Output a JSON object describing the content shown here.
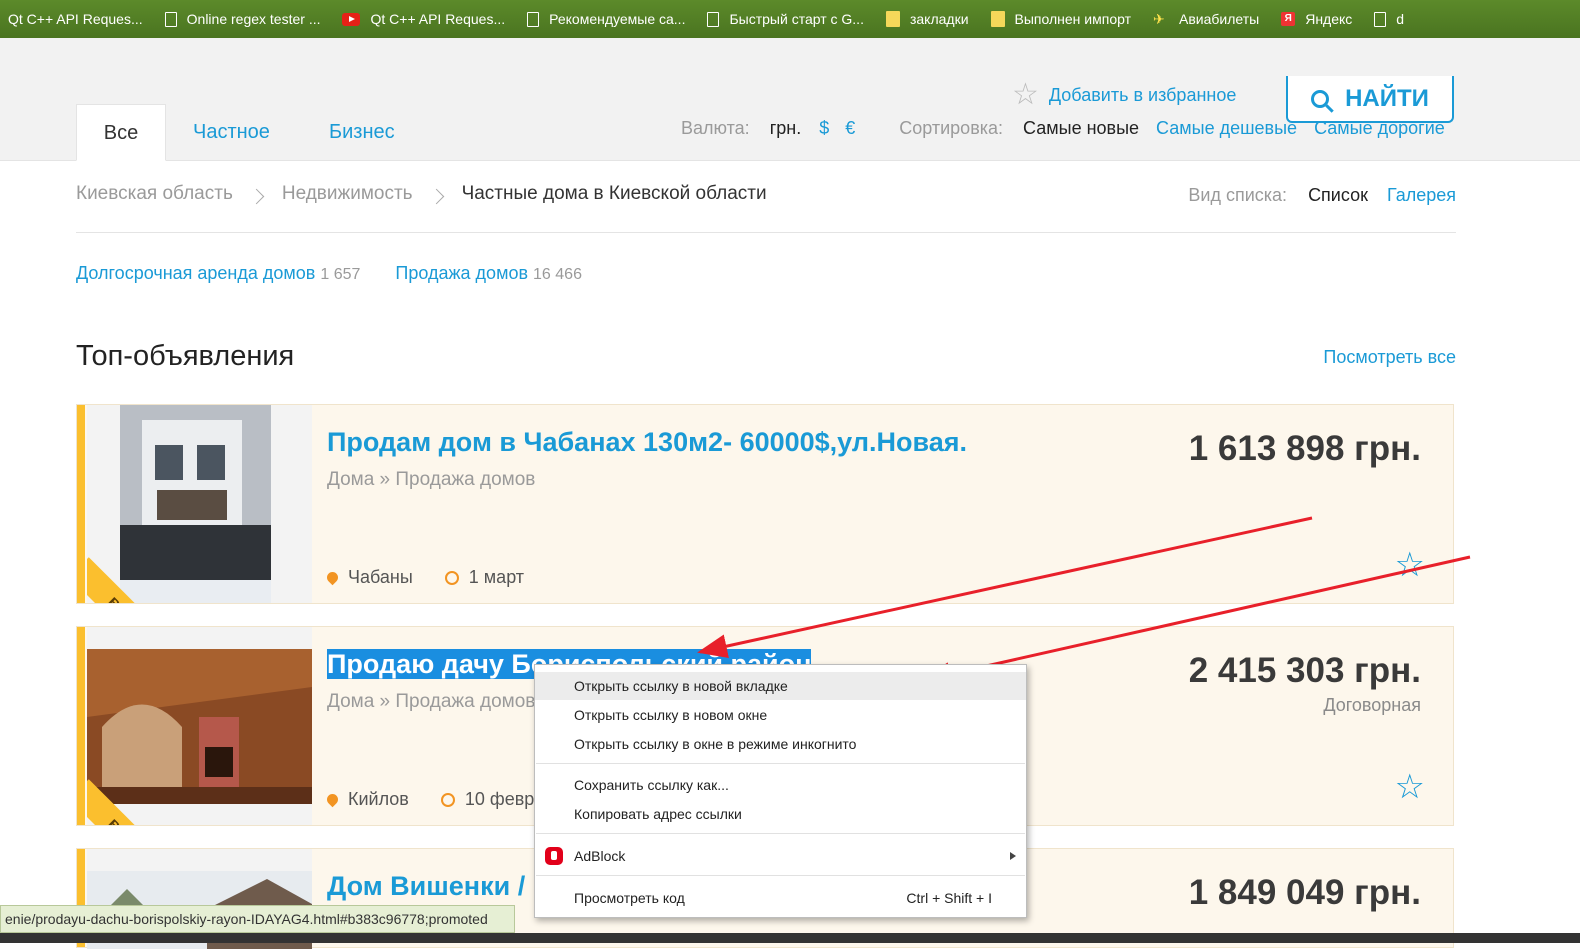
{
  "bookmarks": [
    {
      "label": "Qt C++ API Reques...",
      "icon": "none"
    },
    {
      "label": "Online regex tester ...",
      "icon": "doc"
    },
    {
      "label": "Qt C++ API Reques...",
      "icon": "youtube"
    },
    {
      "label": "Рекомендуемые са...",
      "icon": "doc"
    },
    {
      "label": "Быстрый старт с G...",
      "icon": "doc"
    },
    {
      "label": "закладки",
      "icon": "folder"
    },
    {
      "label": "Выполнен импорт",
      "icon": "folder"
    },
    {
      "label": "Авиабилеты",
      "icon": "plane"
    },
    {
      "label": "Яндекс",
      "icon": "yandex"
    },
    {
      "label": "d",
      "icon": "doc"
    }
  ],
  "header": {
    "favorite": "Добавить в избранное",
    "find": "НАЙТИ",
    "tabs": [
      "Все",
      "Частное",
      "Бизнес"
    ],
    "currency_label": "Валюта:",
    "currencies": [
      "грн.",
      "$",
      "€"
    ],
    "sort_label": "Сортировка:",
    "sort": [
      "Самые новые",
      "Самые дешевые",
      "Самые дорогие"
    ]
  },
  "breadcrumbs": [
    "Киевская область",
    "Недвижимость",
    "Частные дома в Киевской области"
  ],
  "view": {
    "label": "Вид списка:",
    "list": "Список",
    "gallery": "Галерея"
  },
  "subcategories": [
    {
      "name": "Долгосрочная аренда домов",
      "count": "1 657"
    },
    {
      "name": "Продажа домов",
      "count": "16 466"
    }
  ],
  "top": {
    "title": "Топ-объявления",
    "see_all": "Посмотреть все"
  },
  "listings": [
    {
      "title": "Продам дом в Чабанах 130м2- 60000$,ул.Новая.",
      "category": "Дома » Продажа домов",
      "price": "1 613 898 грн.",
      "negotiable": "",
      "location": "Чабаны",
      "date": "1 март",
      "badge": "в ТОПе"
    },
    {
      "title": "Продаю дачу Бориспольский район",
      "category": "Дома » Продажа домов",
      "price": "2 415 303 грн.",
      "negotiable": "Договорная",
      "location": "Кийлов",
      "date": "10 февр",
      "badge": "в ТОПе"
    },
    {
      "title": "Дом Вишенки /",
      "category": "",
      "price": "1 849 049 грн.",
      "negotiable": "",
      "location": "",
      "date": "",
      "badge": ""
    }
  ],
  "context_menu": {
    "open_new_tab": "Открыть ссылку в новой вкладке",
    "open_new_window": "Открыть ссылку в новом окне",
    "open_incognito": "Открыть ссылку в окне в режиме инкогнито",
    "save_link": "Сохранить ссылку как...",
    "copy_link": "Копировать адрес ссылки",
    "adblock": "AdBlock",
    "inspect": "Просмотреть код",
    "inspect_shortcut": "Ctrl + Shift + I"
  },
  "status_url": "enie/prodayu-dachu-borispolskiy-rayon-IDAYAG4.html#b383c96778;promoted",
  "colors": {
    "accent": "#1a9ad6",
    "top_badge": "#fbbf2e",
    "bookmarks_bar": "#4f7a22",
    "arrow": "#e8202a"
  }
}
